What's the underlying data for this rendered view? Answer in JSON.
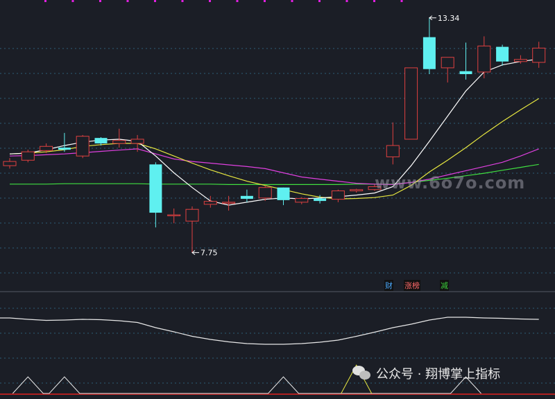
{
  "chart_data": [
    {
      "type": "candlestick",
      "title": "",
      "colors": {
        "up": "#e04040",
        "down": "#5ff0f0",
        "ma_fast": "#ffffff",
        "ma_mid": "#e8e840",
        "ma_slow": "#e040e0",
        "ma_long": "#40e040"
      },
      "ylim": [
        7.2,
        13.6
      ],
      "candles": [
        {
          "o": 9.82,
          "h": 10.0,
          "l": 9.75,
          "c": 9.92
        },
        {
          "o": 9.95,
          "h": 10.2,
          "l": 9.9,
          "c": 10.15
        },
        {
          "o": 10.18,
          "h": 10.35,
          "l": 10.12,
          "c": 10.28
        },
        {
          "o": 10.25,
          "h": 10.6,
          "l": 10.15,
          "c": 10.2
        },
        {
          "o": 10.05,
          "h": 10.55,
          "l": 10.0,
          "c": 10.52
        },
        {
          "o": 10.48,
          "h": 10.5,
          "l": 10.3,
          "c": 10.35
        },
        {
          "o": 10.35,
          "h": 10.7,
          "l": 10.25,
          "c": 10.42
        },
        {
          "o": 10.35,
          "h": 10.55,
          "l": 10.15,
          "c": 10.45
        },
        {
          "o": 9.85,
          "h": 9.9,
          "l": 8.35,
          "c": 8.7
        },
        {
          "o": 8.65,
          "h": 8.8,
          "l": 8.45,
          "c": 8.65
        },
        {
          "o": 8.5,
          "h": 8.85,
          "l": 7.75,
          "c": 8.78
        },
        {
          "o": 8.9,
          "h": 9.1,
          "l": 8.82,
          "c": 8.97
        },
        {
          "o": 8.95,
          "h": 9.1,
          "l": 8.75,
          "c": 8.95
        },
        {
          "o": 9.1,
          "h": 9.25,
          "l": 8.95,
          "c": 9.03
        },
        {
          "o": 9.05,
          "h": 9.35,
          "l": 8.98,
          "c": 9.3
        },
        {
          "o": 9.3,
          "h": 9.3,
          "l": 8.88,
          "c": 9.0
        },
        {
          "o": 8.95,
          "h": 9.07,
          "l": 8.9,
          "c": 9.04
        },
        {
          "o": 9.04,
          "h": 9.12,
          "l": 8.92,
          "c": 8.98
        },
        {
          "o": 9.02,
          "h": 9.25,
          "l": 8.95,
          "c": 9.22
        },
        {
          "o": 9.22,
          "h": 9.27,
          "l": 9.18,
          "c": 9.25
        },
        {
          "o": 9.25,
          "h": 9.37,
          "l": 9.22,
          "c": 9.32
        },
        {
          "o": 10.03,
          "h": 10.85,
          "l": 9.85,
          "c": 10.3
        },
        {
          "o": 10.45,
          "h": 12.15,
          "l": 10.45,
          "c": 12.15
        },
        {
          "o": 12.88,
          "h": 13.34,
          "l": 12.0,
          "c": 12.12
        },
        {
          "o": 12.15,
          "h": 12.4,
          "l": 11.8,
          "c": 12.4
        },
        {
          "o": 12.07,
          "h": 12.75,
          "l": 11.87,
          "c": 12.0
        },
        {
          "o": 12.05,
          "h": 12.9,
          "l": 11.9,
          "c": 12.67
        },
        {
          "o": 12.65,
          "h": 12.7,
          "l": 12.2,
          "c": 12.3
        },
        {
          "o": 12.3,
          "h": 12.45,
          "l": 12.25,
          "c": 12.35
        },
        {
          "o": 12.28,
          "h": 12.77,
          "l": 12.15,
          "c": 12.62
        }
      ],
      "ma_fast": [
        10.1,
        10.12,
        10.2,
        10.3,
        10.38,
        10.43,
        10.45,
        10.4,
        10.05,
        9.65,
        9.3,
        8.98,
        8.88,
        8.95,
        9.02,
        9.05,
        9.03,
        9.05,
        9.08,
        9.12,
        9.17,
        9.32,
        9.82,
        10.4,
        11.0,
        11.6,
        12.05,
        12.22,
        12.3,
        12.36
      ],
      "ma_mid": [
        10.1,
        10.12,
        10.15,
        10.2,
        10.28,
        10.32,
        10.35,
        10.35,
        10.22,
        10.05,
        9.88,
        9.72,
        9.58,
        9.45,
        9.35,
        9.25,
        9.15,
        9.07,
        9.03,
        9.04,
        9.06,
        9.12,
        9.35,
        9.67,
        9.95,
        10.25,
        10.57,
        10.87,
        11.15,
        11.42
      ],
      "ma_slow": [
        10.05,
        10.06,
        10.08,
        10.1,
        10.13,
        10.16,
        10.19,
        10.22,
        10.1,
        9.98,
        9.92,
        9.88,
        9.84,
        9.8,
        9.75,
        9.65,
        9.55,
        9.5,
        9.45,
        9.4,
        9.38,
        9.37,
        9.42,
        9.5,
        9.6,
        9.7,
        9.8,
        9.9,
        10.05,
        10.22
      ],
      "ma_long": [
        9.38,
        9.38,
        9.38,
        9.39,
        9.39,
        9.39,
        9.39,
        9.39,
        9.38,
        9.38,
        9.38,
        9.38,
        9.37,
        9.37,
        9.37,
        9.37,
        9.37,
        9.37,
        9.37,
        9.38,
        9.38,
        9.38,
        9.42,
        9.47,
        9.52,
        9.58,
        9.64,
        9.71,
        9.78,
        9.85
      ],
      "annotations": [
        {
          "label": "13.34",
          "index": 23,
          "price": 13.34
        },
        {
          "label": "7.75",
          "index": 10,
          "price": 7.75
        }
      ]
    },
    {
      "type": "line",
      "title": "",
      "ylim": [
        0,
        1
      ],
      "series": [
        {
          "color": "#e8e8e8",
          "values": [
            0.86,
            0.82,
            0.79,
            0.8,
            0.82,
            0.81,
            0.78,
            0.73,
            0.58,
            0.46,
            0.33,
            0.24,
            0.17,
            0.12,
            0.1,
            0.1,
            0.12,
            0.16,
            0.22,
            0.33,
            0.45,
            0.58,
            0.68,
            0.8,
            0.88,
            0.88,
            0.86,
            0.85,
            0.83,
            0.82
          ]
        }
      ]
    },
    {
      "type": "line",
      "title": "",
      "ylim": [
        0,
        1
      ],
      "series": [
        {
          "color": "#e8e8e8",
          "values": [
            0,
            1,
            0,
            1,
            0,
            0,
            0,
            0,
            0,
            0,
            0,
            0,
            0,
            0,
            0,
            1,
            0,
            0,
            0,
            0,
            0,
            0,
            0,
            0,
            0,
            1,
            0,
            0,
            0,
            0
          ]
        },
        {
          "color": "#e8e840",
          "values": [
            0,
            0,
            0,
            0,
            0,
            0,
            0,
            0,
            0,
            0,
            0,
            0,
            0,
            0,
            0,
            0,
            0,
            0,
            0,
            1,
            0,
            0,
            0,
            0,
            0,
            0,
            0,
            0,
            0,
            0
          ]
        }
      ]
    }
  ],
  "signal_tags": {
    "cai": "财",
    "zhangbang": "涨榜",
    "jian": "减"
  },
  "watermarks": {
    "site": "www.6o7o.com",
    "account": "公众号 · 翔博掌上指标"
  }
}
